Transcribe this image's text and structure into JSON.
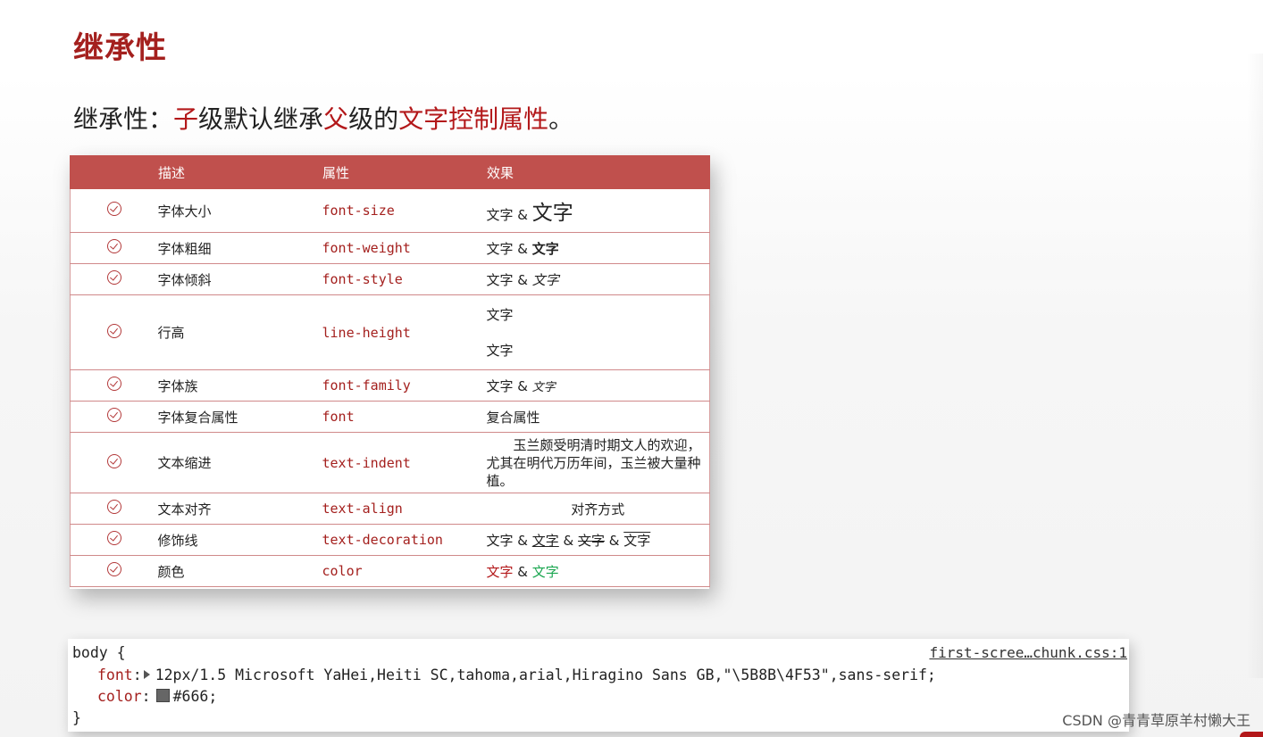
{
  "slide": {
    "title": "继承性",
    "subtitle": {
      "parts": [
        "继承性：",
        "子",
        "级默认继承",
        "父",
        "级的",
        "文字控制属性",
        "。"
      ]
    }
  },
  "table": {
    "headers": [
      "",
      "描述",
      "属性",
      "效果"
    ],
    "rows": [
      {
        "desc": "字体大小",
        "prop": "font-size",
        "effect": [
          "文字",
          " & ",
          "文字"
        ]
      },
      {
        "desc": "字体粗细",
        "prop": "font-weight",
        "effect": [
          "文字",
          " & ",
          "文字"
        ]
      },
      {
        "desc": "字体倾斜",
        "prop": "font-style",
        "effect": [
          "文字",
          " & ",
          "文字"
        ]
      },
      {
        "desc": "行高",
        "prop": "line-height",
        "effect": [
          "文字",
          "文字"
        ]
      },
      {
        "desc": "字体族",
        "prop": "font-family",
        "effect": [
          "文字",
          " & ",
          "文字"
        ]
      },
      {
        "desc": "字体复合属性",
        "prop": "font",
        "effect": [
          "复合属性"
        ]
      },
      {
        "desc": "文本缩进",
        "prop": "text-indent",
        "effect": [
          "玉兰颇受明清时期文人的欢迎，尤其在明代万历年间，玉兰被大量种植。"
        ]
      },
      {
        "desc": "文本对齐",
        "prop": "text-align",
        "effect": [
          "对齐方式"
        ]
      },
      {
        "desc": "修饰线",
        "prop": "text-decoration",
        "effect": [
          "文字",
          " & ",
          "文字",
          " & ",
          "文字",
          " & ",
          "文字"
        ]
      },
      {
        "desc": "颜色",
        "prop": "color",
        "effect": [
          "文字",
          " & ",
          "文字"
        ]
      }
    ]
  },
  "devtools": {
    "selector": "body {",
    "source": "first-scree…chunk.css:1",
    "font_prop": "font",
    "font_value": "12px/1.5 Microsoft YaHei,Heiti SC,tahoma,arial,Hiragino Sans GB,\"\\5B8B\\4F53\",sans-serif;",
    "color_prop": "color",
    "color_value": "#666;",
    "colon": ":",
    "close": "}"
  },
  "watermark": "CSDN @青青草原羊村懒大王",
  "colors": {
    "accent": "#c0504d",
    "title_red": "#a4201e",
    "green": "#1aa650",
    "swatch": "#666666"
  }
}
